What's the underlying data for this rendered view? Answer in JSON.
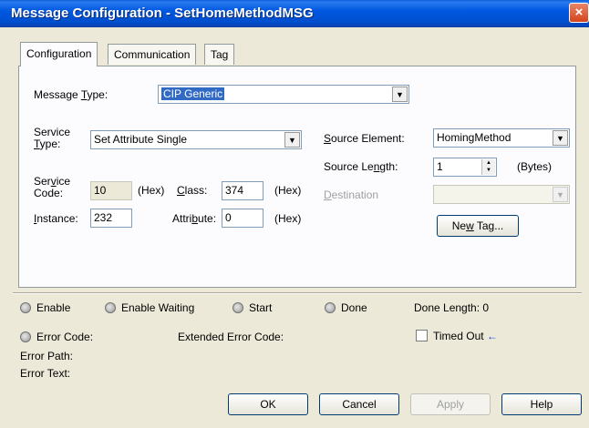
{
  "window": {
    "title": "Message Configuration - SetHomeMethodMSG",
    "close_icon": "×"
  },
  "tabs": [
    {
      "label": "Configuration"
    },
    {
      "label": "Communication"
    },
    {
      "label": "Tag"
    }
  ],
  "config": {
    "message_type_prefix": "Message ",
    "message_type_key": "T",
    "message_type_suffix": "ype:",
    "message_type_value": "CIP Generic",
    "service_type_line1": "Service",
    "service_type_line2_key": "T",
    "service_type_line2_rest": "ype:",
    "service_type_value": "Set Attribute Single",
    "service_code_line1_pre": "Ser",
    "service_code_line1_key": "v",
    "service_code_line1_post": "ice",
    "service_code_line2": "Code:",
    "service_code_value": "10",
    "hex1": "(Hex)",
    "class_key": "C",
    "class_rest": "lass:",
    "class_value": "374",
    "hex2": "(Hex)",
    "instance_key": "I",
    "instance_rest": "nstance:",
    "instance_value": "232",
    "attribute_pre": "Attri",
    "attribute_key": "b",
    "attribute_post": "ute:",
    "attribute_value": "0",
    "hex3": "(Hex)",
    "source_element_key": "S",
    "source_element_rest": "ource Element:",
    "source_element_value": "HomingMethod",
    "source_length_pre": "Source Le",
    "source_length_key": "n",
    "source_length_post": "gth:",
    "source_length_value": "1",
    "bytes": "(Bytes)",
    "destination_key": "D",
    "destination_rest": "estination",
    "new_tag_pre": "Ne",
    "new_tag_key": "w",
    "new_tag_post": " Tag..."
  },
  "status": {
    "enable": "Enable",
    "enable_waiting": "Enable Waiting",
    "start": "Start",
    "done": "Done",
    "done_length": "Done Length: 0",
    "error_code": "Error Code:",
    "extended_error_code": "Extended Error Code:",
    "timed_out": "Timed Out",
    "timed_out_arrow": "←",
    "error_path": "Error Path:",
    "error_text": "Error Text:"
  },
  "buttons": {
    "ok": "OK",
    "cancel": "Cancel",
    "apply": "Apply",
    "help": "Help"
  },
  "colors": {
    "title_bar": "#0058e0",
    "selection": "#316ac5",
    "arrow": "#1a3fd1"
  }
}
